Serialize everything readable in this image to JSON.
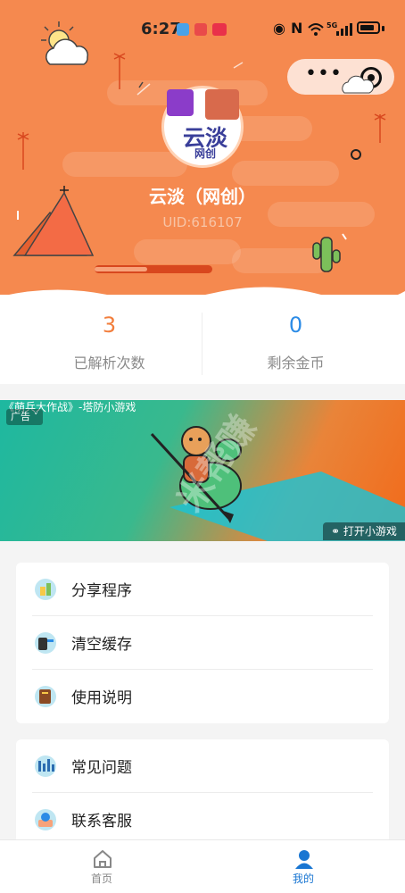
{
  "status_bar": {
    "time": "6:27",
    "network": "5G"
  },
  "profile": {
    "avatar_text_main": "云淡",
    "avatar_text_sub": "网创",
    "name": "云淡（网创）",
    "uid": "UID:616107",
    "progress": 0.45
  },
  "stats": [
    {
      "value": "3",
      "label": "已解析次数",
      "color": "#f27e3c"
    },
    {
      "value": "0",
      "label": "剩余金币",
      "color": "#2b8be6"
    }
  ],
  "ad": {
    "title": "《萌兵大作战》-塔防小游戏",
    "tag": "广告",
    "open_label": "打开小游戏",
    "watermark": "米帮赚"
  },
  "menu_group_1": [
    {
      "label": "分享程序",
      "icon": "share-icon"
    },
    {
      "label": "清空缓存",
      "icon": "trash-icon"
    },
    {
      "label": "使用说明",
      "icon": "book-icon"
    }
  ],
  "menu_group_2": [
    {
      "label": "常见问题",
      "icon": "chart-question-icon"
    },
    {
      "label": "联系客服",
      "icon": "customer-service-icon"
    }
  ],
  "tabbar": {
    "home_label": "首页",
    "mine_label": "我的",
    "active_color": "#1976d2",
    "inactive_color": "#888888"
  }
}
